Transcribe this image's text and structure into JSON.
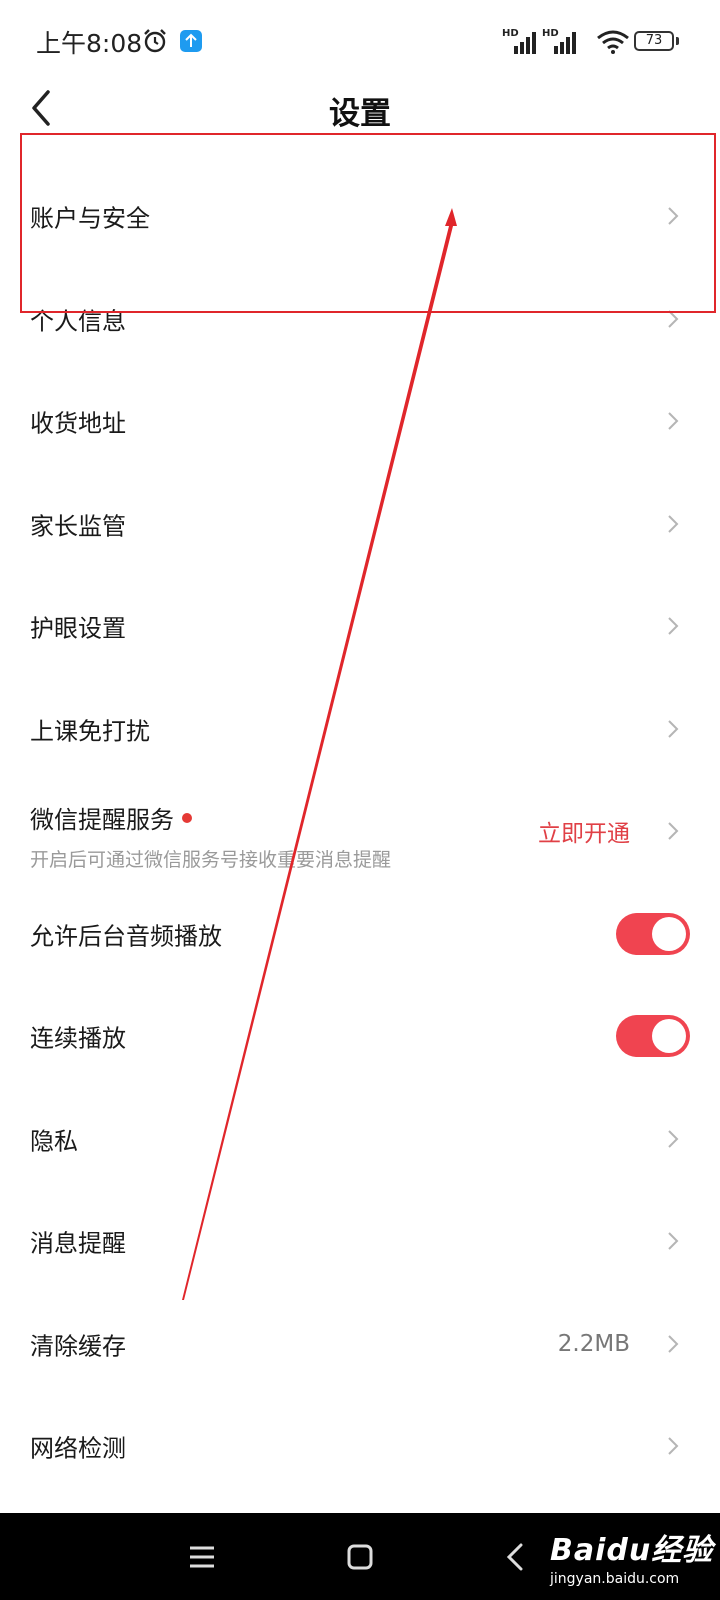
{
  "status_bar": {
    "time": "上午8:08",
    "signal_label_1": "HD",
    "signal_label_2": "HD",
    "battery_level": "73"
  },
  "header": {
    "title": "设置",
    "back_icon": "back-icon"
  },
  "settings": {
    "account_security": "账户与安全",
    "personal_info": "个人信息",
    "shipping_address": "收货地址",
    "parental_control": "家长监管",
    "eye_care": "护眼设置",
    "class_dnd": "上课免打扰",
    "wechat_reminder": {
      "label": "微信提醒服务",
      "subtitle": "开启后可通过微信服务号接收重要消息提醒",
      "action": "立即开通"
    },
    "bg_audio": {
      "label": "允许后台音频播放",
      "on": true
    },
    "continuous_play": {
      "label": "连续播放",
      "on": true
    },
    "privacy": "隐私",
    "notifications": "消息提醒",
    "clear_cache": {
      "label": "清除缓存",
      "value": "2.2MB"
    },
    "network_check": "网络检测"
  },
  "watermark": {
    "brand": "Baidu经验",
    "url": "jingyan.baidu.com"
  },
  "colors": {
    "accent": "#e04046",
    "toggle_on": "#f04450",
    "annotation": "#e0262b"
  }
}
